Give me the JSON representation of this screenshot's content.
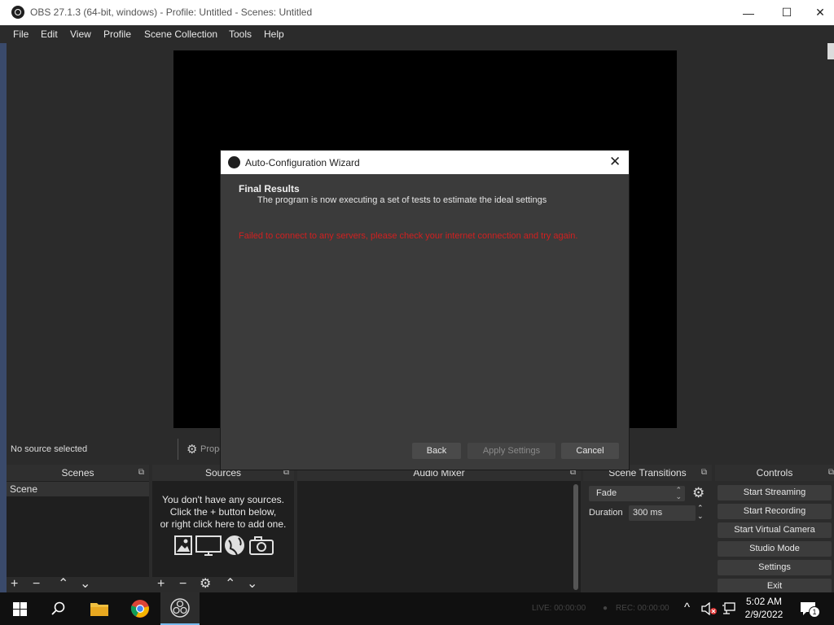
{
  "window": {
    "title": "OBS 27.1.3 (64-bit, windows) - Profile: Untitled - Scenes: Untitled",
    "minimize": "—",
    "maximize": "☐",
    "close": "✕"
  },
  "menu": [
    "File",
    "Edit",
    "View",
    "Profile",
    "Scene Collection",
    "Tools",
    "Help"
  ],
  "source_bar": {
    "no_source": "No source selected",
    "properties": "Propert"
  },
  "docks": {
    "scenes": {
      "title": "Scenes",
      "items": [
        "Scene"
      ]
    },
    "sources": {
      "title": "Sources",
      "empty_lines": [
        "You don't have any sources.",
        "Click the + button below,",
        "or right click here to add one."
      ]
    },
    "audio_mixer": {
      "title": "Audio Mixer"
    },
    "scene_transitions": {
      "title": "Scene Transitions",
      "transition_value": "Fade",
      "duration_label": "Duration",
      "duration_value": "300 ms"
    },
    "controls": {
      "title": "Controls",
      "buttons": [
        "Start Streaming",
        "Start Recording",
        "Start Virtual Camera",
        "Studio Mode",
        "Settings",
        "Exit"
      ]
    }
  },
  "wizard": {
    "title": "Auto-Configuration Wizard",
    "heading": "Final Results",
    "subtitle": "The program is now executing a set of tests to estimate the ideal settings",
    "error": "Failed to connect to any servers, please check your internet connection and try again.",
    "close": "✕",
    "buttons": {
      "back": "Back",
      "apply": "Apply Settings",
      "cancel": "Cancel"
    }
  },
  "status": {
    "live": "LIVE: 00:00:00",
    "rec": "REC: 00:00:00"
  },
  "taskbar": {
    "time": "5:02 AM",
    "date": "2/9/2022",
    "notification_count": "1"
  },
  "colors": {
    "error": "#d12020",
    "accent_blue": "#0078d7"
  }
}
